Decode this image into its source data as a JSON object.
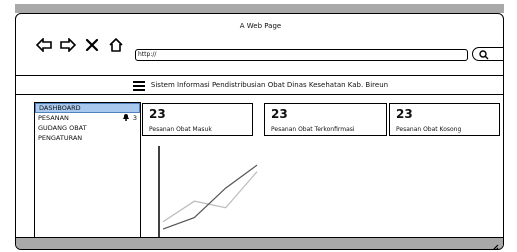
{
  "window": {
    "title": "A Web Page"
  },
  "browser": {
    "address": "http://",
    "icons": [
      "back-arrow-icon",
      "forward-arrow-icon",
      "close-x-icon",
      "home-icon"
    ],
    "search_icon": "search-icon"
  },
  "header": {
    "menu_icon": "hamburger-menu-icon",
    "title": "Sistem Informasi Pendistribusian Obat Dinas Kesehatan Kab. Bireun"
  },
  "sidebar": {
    "items": [
      {
        "label": "DASHBOARD",
        "active": true
      },
      {
        "label": "PESANAN",
        "badge_icon": "bell-icon",
        "badge_count": "3"
      },
      {
        "label": "GUDANG OBAT"
      },
      {
        "label": "PENGATURAN"
      }
    ]
  },
  "cards": [
    {
      "value": "23",
      "label": "Pesanan Obat Masuk"
    },
    {
      "value": "23",
      "label": "Pesanan Obat Terkonfirmasi"
    },
    {
      "value": "23",
      "label": "Pesanan Obat Kosong"
    }
  ],
  "chart_data": {
    "type": "line",
    "title": "",
    "xlabel": "",
    "ylabel": "",
    "x": [
      0,
      1,
      2,
      3
    ],
    "xlim": [
      0,
      3
    ],
    "ylim": [
      0,
      10
    ],
    "series": [
      {
        "values": [
          1.5,
          4.0,
          3.2,
          7.6
        ],
        "color": "#bbbbbb"
      },
      {
        "values": [
          0.6,
          2.0,
          5.6,
          8.4
        ],
        "color": "#555555"
      }
    ],
    "grid": false,
    "legend": "none"
  }
}
